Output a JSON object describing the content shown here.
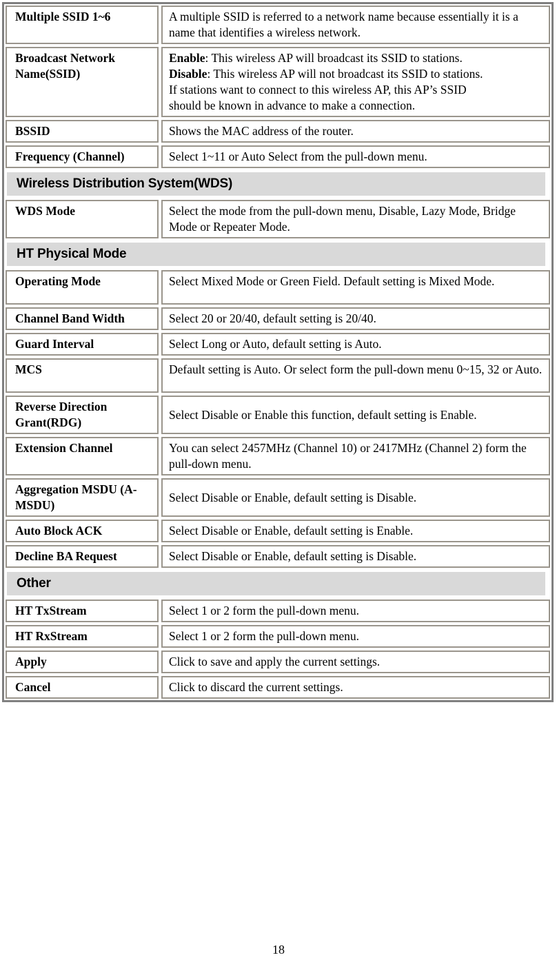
{
  "document": {
    "page_number": "18",
    "colors": {
      "section_header_bg": "#d9d9d9",
      "table_outer_border": "#808080",
      "cell_border": "#9a958c",
      "text": "#000000",
      "background": "#ffffff"
    }
  },
  "table": {
    "rows": [
      {
        "type": "entry",
        "label": "Multiple SSID 1~6",
        "value": "A multiple SSID is referred to a network name because essentially it is a name that identifies a wireless network.",
        "lines": 2
      },
      {
        "type": "entry",
        "label": "Broadcast Network Name(SSID)",
        "value_rich": [
          {
            "bold": "Enable",
            "text": ": This wireless AP will broadcast its SSID to stations."
          },
          {
            "bold": "Disable",
            "text": ": This wireless AP will not broadcast its SSID to stations."
          },
          {
            "bold": "",
            "text": "If stations want to connect to this wireless AP, this AP’s SSID"
          },
          {
            "bold": "",
            "text": "should be known in advance to make a connection."
          }
        ],
        "lines": 4
      },
      {
        "type": "entry",
        "label": "BSSID",
        "value": "Shows the MAC address of the router.",
        "lines": 1
      },
      {
        "type": "entry",
        "label": "Frequency (Channel)",
        "value": "Select 1~11 or Auto Select from the pull-down menu.",
        "lines": 1
      },
      {
        "type": "section",
        "label": "Wireless Distribution System(WDS)"
      },
      {
        "type": "entry",
        "label": "WDS Mode",
        "value": "Select the mode from the pull-down menu, Disable, Lazy Mode, Bridge Mode or Repeater Mode.",
        "lines": 2
      },
      {
        "type": "section",
        "label": "HT Physical Mode"
      },
      {
        "type": "entry",
        "label": "Operating Mode",
        "value": "Select Mixed Mode or Green Field. Default setting is Mixed Mode.",
        "lines": 2
      },
      {
        "type": "entry",
        "label": "Channel Band Width",
        "value": "Select 20 or 20/40, default setting is 20/40.",
        "lines": 1
      },
      {
        "type": "entry",
        "label": "Guard Interval",
        "value": "Select Long or Auto, default setting is Auto.",
        "lines": 1
      },
      {
        "type": "entry",
        "label": "MCS",
        "value": "Default setting is Auto. Or select form the pull-down menu 0~15, 32 or Auto.",
        "lines": 2
      },
      {
        "type": "entry",
        "label": "Reverse Direction Grant(RDG)",
        "value": "Select Disable or Enable this function, default setting is Enable.",
        "lines": 1,
        "value_centered": true
      },
      {
        "type": "entry",
        "label": "Extension Channel",
        "value": "You can select 2457MHz (Channel 10) or 2417MHz (Channel 2) form the pull-down menu.",
        "lines": 2
      },
      {
        "type": "entry",
        "label": "Aggregation MSDU (A-MSDU)",
        "value": "Select Disable or Enable, default setting is Disable.",
        "lines": 1,
        "value_centered": true
      },
      {
        "type": "entry",
        "label": "Auto Block ACK",
        "value": "Select Disable or Enable, default setting is Enable.",
        "lines": 1
      },
      {
        "type": "entry",
        "label": "Decline BA Request",
        "value": "Select Disable or Enable, default setting is Disable.",
        "lines": 1
      },
      {
        "type": "section",
        "label": "Other"
      },
      {
        "type": "entry",
        "label": "HT TxStream",
        "value": "Select 1 or 2 form the pull-down menu.",
        "lines": 1
      },
      {
        "type": "entry",
        "label": "HT RxStream",
        "value": "Select 1 or 2 form the pull-down menu.",
        "lines": 1
      },
      {
        "type": "entry",
        "label": "Apply",
        "value": "Click to save and apply the current settings.",
        "lines": 1
      },
      {
        "type": "entry",
        "label": "Cancel",
        "value": "Click to discard the current settings.",
        "lines": 1
      }
    ]
  }
}
